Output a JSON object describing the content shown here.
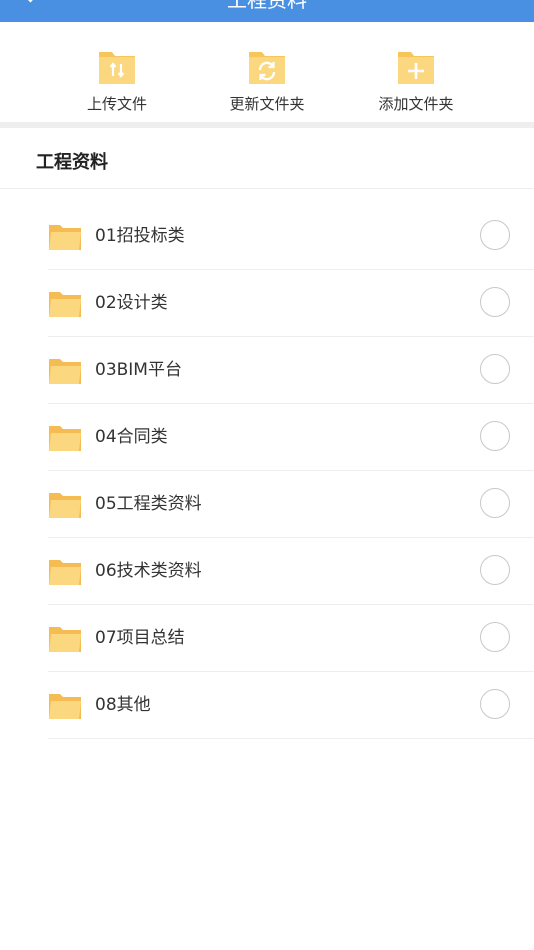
{
  "header": {
    "title": "工程资料"
  },
  "toolbar": {
    "items": [
      {
        "label": "上传文件",
        "icon": "upload-folder-icon"
      },
      {
        "label": "更新文件夹",
        "icon": "refresh-folder-icon"
      },
      {
        "label": "添加文件夹",
        "icon": "add-folder-icon"
      }
    ]
  },
  "section": {
    "title": "工程资料"
  },
  "folders": [
    {
      "name": "01招投标类",
      "selected": false
    },
    {
      "name": "02设计类",
      "selected": false
    },
    {
      "name": "03BIM平台",
      "selected": false
    },
    {
      "name": "04合同类",
      "selected": false
    },
    {
      "name": "05工程类资料",
      "selected": false
    },
    {
      "name": "06技术类资料",
      "selected": false
    },
    {
      "name": "07项目总结",
      "selected": false
    },
    {
      "name": "08其他",
      "selected": false
    }
  ],
  "colors": {
    "accent": "#4a90e2",
    "folder": "#f7c65b",
    "folder_light": "#fbd77f"
  }
}
